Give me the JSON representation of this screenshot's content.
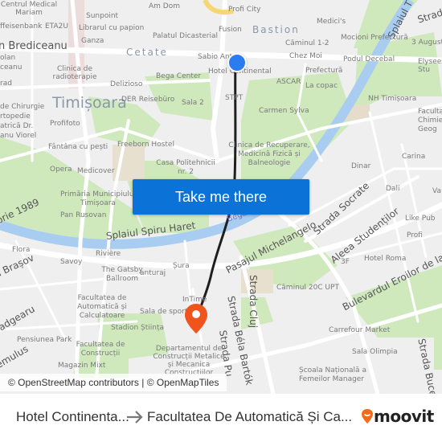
{
  "map": {
    "districts": [
      "Cetate",
      "Bastion"
    ],
    "city": "Timișoara",
    "streets": [
      "n Brediceanu",
      "Splaiul Spiru Haret",
      "Pasajul Michelangelo",
      "Strada Socrate",
      "Aleea Studenților",
      "Bulevardul Eroilor de la",
      "Strada Cluj",
      "Strada Béla Bartók",
      "Strada Pu",
      "Splaiul T",
      "Strad",
      "orie 1989",
      "a Brașov",
      "Iadgearu",
      "emulus",
      "Strada Buce",
      "Bega"
    ],
    "pois": [
      "Centrul Medical Mariam",
      "Am Dom",
      "Profi City",
      "Sunpoint",
      "ffeisenbank",
      "ETA2U",
      "Librarul cu papion",
      "Medici's",
      "Fusion",
      "Bastion",
      "Ganza",
      "Palatul Dicasterial",
      "Căminul 1-2",
      "Mocioni Prefectură",
      "3 August",
      "Sabio Ant",
      "Chez Moi",
      "Podul Decebal",
      "Elysees Stu",
      "olan",
      "ceanu",
      "Clinica de radioterapie",
      "Hotel Continental",
      "Bega Center",
      "Prefectură",
      "rad",
      "Delizioso",
      "ASCAR",
      "La copac",
      "DER Reisebüro",
      "Sala 2",
      "NH Timișoara",
      "de Chirurgie",
      "rtopedie",
      "atrică Dr.",
      "anu Viorel",
      "Profifoto",
      "STPT",
      "Carmen Sylva",
      "Faculta Chimie-I Geog",
      "Fântâna cu pești",
      "Freeborn Hostel",
      "Clinica de Recuperare, Medicină Fizică și Balneologie",
      "Carina",
      "Casa Politehnicii nr. 2",
      "Opera",
      "Medicover",
      "Dinar",
      "Dali",
      "Va",
      "Primăria Municipiului Timișoara",
      "Pan Rusovan",
      "Like Pub",
      "Profi",
      "Flora",
      "Rivière",
      "Savoy",
      "The Gatsby Ballroom",
      "anturaj",
      "Șura",
      "3F",
      "Hotel Roma",
      "Căminul 20C UPT",
      "InTime",
      "Facultatea de Automatică și Calculatoare",
      "Sala de sport",
      "Stadion Știința",
      "Carrefour Market",
      "Pensiunea Park",
      "Facultatea de Construcții",
      "Departamentul de Construcții Metalice și Mecanica Construcțiilor",
      "Sala Olimpia",
      "Magazin Mixt",
      "Școala Națională a Femeilor Manager"
    ],
    "take_me_there": "Take me there",
    "attribution": "© OpenStreetMap contributors | © OpenMapTiles",
    "colors": {
      "route": "#1f1f1f",
      "origin": "#2b7bf1",
      "destination": "#f0531c",
      "button": "#0b72d7",
      "river": "#a8cdf0",
      "park": "#c9e8b4"
    }
  },
  "footer": {
    "from": "Hotel Continenta...",
    "to": "Facultatea De Automatică Și Ca...",
    "logo": "moovit",
    "logo_color": "#f26b1d"
  }
}
